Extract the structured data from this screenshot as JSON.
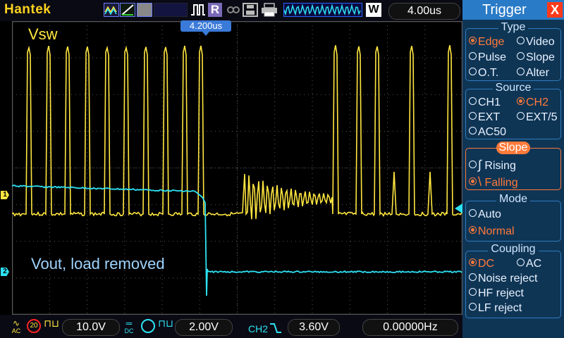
{
  "topbar": {
    "brand": "Hantek",
    "timebase": "4.00us",
    "run_label": "R",
    "window_label": "W"
  },
  "plot": {
    "trigger_position_label": "4.200us",
    "label_top": "Vsw",
    "label_bottom": "Vout, load removed",
    "ch1_marker": "1",
    "ch2_marker": "2"
  },
  "bottombar": {
    "ch1_coupling": "AC",
    "ch1_bw": "20",
    "ch1_scale": "10.0V",
    "ch2_coupling": "DC",
    "ch2_scale": "2.00V",
    "trigger_source": "CH2",
    "trigger_level": "3.60V",
    "frequency": "0.00000Hz"
  },
  "menu": {
    "title": "Trigger",
    "close": "X",
    "type": {
      "heading": "Type",
      "options": [
        "Edge",
        "Video",
        "Pulse",
        "Slope",
        "O.T.",
        "Alter"
      ],
      "selected": "Edge"
    },
    "source": {
      "heading": "Source",
      "options": [
        "CH1",
        "CH2",
        "EXT",
        "EXT/5",
        "AC50"
      ],
      "selected": "CH2"
    },
    "slope": {
      "heading": "Slope",
      "options": [
        "Rising",
        "Falling"
      ],
      "selected": "Falling"
    },
    "mode": {
      "heading": "Mode",
      "options": [
        "Auto",
        "Normal"
      ],
      "selected": "Normal"
    },
    "coupling": {
      "heading": "Coupling",
      "options": [
        "DC",
        "AC",
        "Noise reject",
        "HF reject",
        "LF reject"
      ],
      "selected": "DC"
    }
  },
  "colors": {
    "ch1": "#ffe640",
    "ch2": "#2ee2f4",
    "grid": "#5a5a5a",
    "menu_bg": "#0f3555",
    "menu_accent": "#ff7a3a",
    "menu_title": "#2a7bc7"
  }
}
